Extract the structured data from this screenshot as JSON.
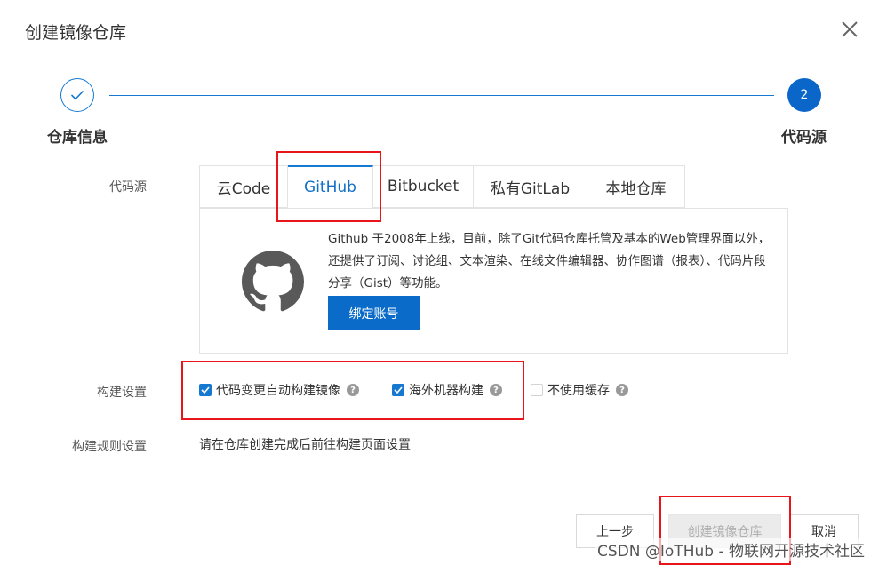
{
  "dialog": {
    "title": "创建镜像仓库"
  },
  "steps": [
    {
      "label": "仓库信息",
      "status": "done"
    },
    {
      "label": "代码源",
      "number": "2",
      "status": "current"
    }
  ],
  "form": {
    "source_label": "代码源",
    "build_label": "构建设置",
    "rule_label": "构建规则设置",
    "rule_text": "请在仓库创建完成后前往构建页面设置"
  },
  "tabs": [
    {
      "label": "云Code",
      "active": false
    },
    {
      "label": "GitHub",
      "active": true
    },
    {
      "label": "Bitbucket",
      "active": false
    },
    {
      "label": "私有GitLab",
      "active": false
    },
    {
      "label": "本地仓库",
      "active": false
    }
  ],
  "github_panel": {
    "description": "Github 于2008年上线，目前，除了Git代码仓库托管及基本的Web管理界面以外，还提供了订阅、讨论组、文本渲染、在线文件编辑器、协作图谱（报表）、代码片段分享（Gist）等功能。",
    "bind_button": "绑定账号"
  },
  "build_options": [
    {
      "label": "代码变更自动构建镜像",
      "checked": true
    },
    {
      "label": "海外机器构建",
      "checked": true
    },
    {
      "label": "不使用缓存",
      "checked": false
    }
  ],
  "footer": {
    "prev_label": "上一步",
    "create_label": "创建镜像仓库",
    "cancel_label": "取消"
  },
  "watermark": "CSDN @IoTHub - 物联网开源技术社区",
  "colors": {
    "primary": "#0a6bc9",
    "highlight": "#e8161b",
    "disabled_text": "#b0b0b0"
  },
  "icons": {
    "close": "close-icon",
    "step_done": "check-icon",
    "github": "github-logo-icon",
    "help": "question-circle-icon",
    "checkbox": "check-icon"
  }
}
